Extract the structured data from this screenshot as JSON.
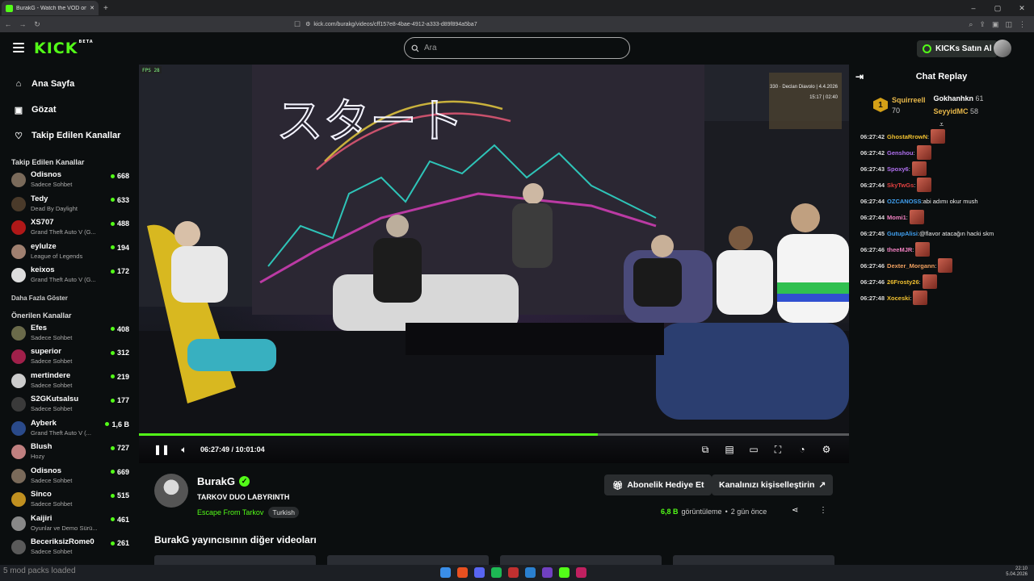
{
  "browser": {
    "tab_title": "BurakG - Watch the VOD on k",
    "url": "kick.com/burakg/videos/cff157e8-4bae-4912-a333-d89f894a5ba7"
  },
  "header": {
    "logo": "KICK",
    "logo_badge": "BETA",
    "search_placeholder": "Ara",
    "kicks_button": "KICKs Satın Al"
  },
  "sidebar": {
    "nav": [
      {
        "label": "Ana Sayfa",
        "icon": "home-icon"
      },
      {
        "label": "Gözat",
        "icon": "browse-icon"
      },
      {
        "label": "Takip Edilen Kanallar",
        "icon": "heart-icon"
      }
    ],
    "followed_title": "Takip Edilen Kanallar",
    "followed": [
      {
        "name": "Odisnos",
        "category": "Sadece Sohbet",
        "viewers": "668",
        "live": true,
        "color": "#7a6a5a"
      },
      {
        "name": "Tedy",
        "category": "Dead By Daylight",
        "viewers": "633",
        "live": false,
        "color": "#4a3a2a"
      },
      {
        "name": "XS707",
        "category": "Grand Theft Auto V (G...",
        "viewers": "488",
        "live": true,
        "color": "#b01818"
      },
      {
        "name": "eylulze",
        "category": "League of Legends",
        "viewers": "194",
        "live": true,
        "color": "#a08070"
      },
      {
        "name": "keixos",
        "category": "Grand Theft Auto V (G...",
        "viewers": "172",
        "live": true,
        "color": "#dddddd"
      }
    ],
    "show_more": "Daha Fazla Göster",
    "suggested_title": "Önerilen Kanallar",
    "suggested": [
      {
        "name": "Efes",
        "category": "Sadece Sohbet",
        "viewers": "408",
        "color": "#6a6a4a"
      },
      {
        "name": "superior",
        "category": "Sadece Sohbet",
        "viewers": "312",
        "color": "#a0204a"
      },
      {
        "name": "mertindere",
        "category": "Sadece Sohbet",
        "viewers": "219",
        "color": "#cccccc"
      },
      {
        "name": "S2GKutsalsu",
        "category": "Sadece Sohbet",
        "viewers": "177",
        "color": "#3a3a3a"
      },
      {
        "name": "Ayberk",
        "category": "Grand Theft Auto V (...",
        "viewers": "1,6 B",
        "color": "#2a4a8a"
      },
      {
        "name": "Blush",
        "category": "Hozy",
        "viewers": "727",
        "color": "#c08080"
      },
      {
        "name": "Odisnos",
        "category": "Sadece Sohbet",
        "viewers": "669",
        "color": "#7a6a5a"
      },
      {
        "name": "Sinco",
        "category": "Sadece Sohbet",
        "viewers": "515",
        "color": "#c09020"
      },
      {
        "name": "Kaijiri",
        "category": "Oyunlar ve Demo Sürü...",
        "viewers": "461",
        "color": "#888888"
      },
      {
        "name": "BeceriksizRome0",
        "category": "Sadece Sohbet",
        "viewers": "261",
        "color": "#5a5a5a"
      }
    ]
  },
  "video": {
    "hud_line1": "330 · Declan Diavolo | 4.4.2026",
    "hud_line2": "15:17  |  02:40",
    "progress": 0.646,
    "time_current": "06:27:49",
    "time_total": "10:01:04",
    "sign_text": "スタート"
  },
  "info": {
    "channel": "BurakG",
    "title": "TARKOV DUO LABYRINTH",
    "category": "Escape From Tarkov",
    "tag": "Turkish",
    "gift_button": "Abonelik Hediye Et",
    "customize_button": "Kanalınızı kişiselleştirin",
    "views_num": "6,8 B",
    "views_label": "görüntüleme",
    "ago": "2 gün önce",
    "more_videos": "BurakG yayıncısının diğer videoları"
  },
  "chat": {
    "title": "Chat Replay",
    "leader_rank": "1",
    "leader": {
      "name": "Squirreell",
      "count": "70"
    },
    "leader2": {
      "name": "Gokhanhkn",
      "count": "61"
    },
    "leader3": {
      "name": "SeyyidMC",
      "count": "58"
    },
    "messages": [
      {
        "ts": "06:27:42",
        "user": "GhostaRrowN",
        "color": "#f0c030",
        "text": "",
        "emote": true
      },
      {
        "ts": "06:27:42",
        "user": "Genshou",
        "color": "#b070f0",
        "text": "",
        "emote": true
      },
      {
        "ts": "06:27:43",
        "user": "Spoxy6",
        "color": "#b070f0",
        "text": "",
        "emote": true
      },
      {
        "ts": "06:27:44",
        "user": "SkyTwGs",
        "color": "#e04040",
        "text": "",
        "emote": true
      },
      {
        "ts": "06:27:44",
        "user": "OZCANOSS",
        "color": "#40a0f0",
        "text": " abi adımı okur mush",
        "emote": false
      },
      {
        "ts": "06:27:44",
        "user": "Momi1",
        "color": "#f080c0",
        "text": "",
        "emote": true
      },
      {
        "ts": "06:27:45",
        "user": "GutupAlisi",
        "color": "#40a0f0",
        "text": " @flavor atacağın hacki skm",
        "emote": false
      },
      {
        "ts": "06:27:46",
        "user": "theeMJR",
        "color": "#f080c0",
        "text": "",
        "emote": true
      },
      {
        "ts": "06:27:46",
        "user": "Dexter_Morgann",
        "color": "#f0a060",
        "text": "",
        "emote": true
      },
      {
        "ts": "06:27:46",
        "user": "26Frosty26",
        "color": "#f0c030",
        "text": "",
        "emote": true
      },
      {
        "ts": "06:27:48",
        "user": "Xoceski",
        "color": "#f0c030",
        "text": "",
        "emote": true
      }
    ]
  },
  "taskbar": {
    "status": "5 mod packs loaded",
    "clock": "22:10",
    "date": "5.04.2026"
  },
  "colors": {
    "accent": "#53fc18",
    "bg": "#0b0e0f"
  }
}
